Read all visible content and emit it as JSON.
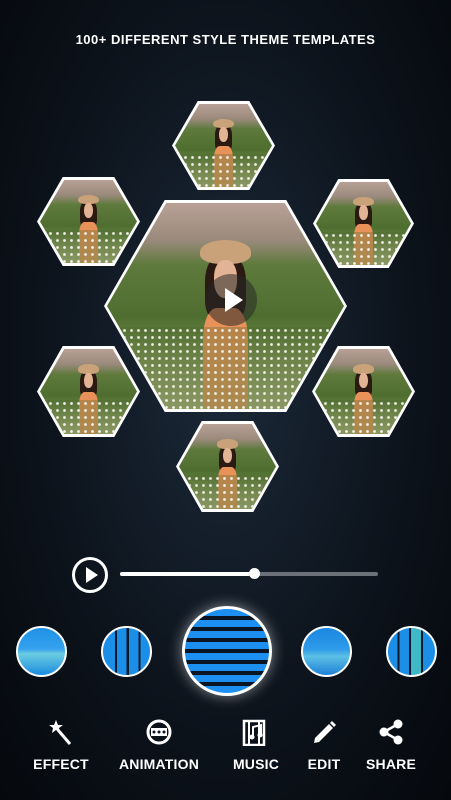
{
  "header": {
    "title": "100+ DIFFERENT STYLE THEME TEMPLATES"
  },
  "player": {
    "progress": 0.52
  },
  "toolbar": [
    {
      "id": "effect",
      "label": "EFFECT",
      "icon": "magic-wand-icon"
    },
    {
      "id": "animation",
      "label": "ANIMATION",
      "icon": "film-reel-icon"
    },
    {
      "id": "music",
      "label": "MUSIC",
      "icon": "music-file-icon"
    },
    {
      "id": "edit",
      "label": "EDIT",
      "icon": "pencil-icon"
    },
    {
      "id": "share",
      "label": "SHARE",
      "icon": "share-icon"
    }
  ],
  "colors": {
    "accent": "#1d8ff0",
    "background": "#0d141d"
  }
}
